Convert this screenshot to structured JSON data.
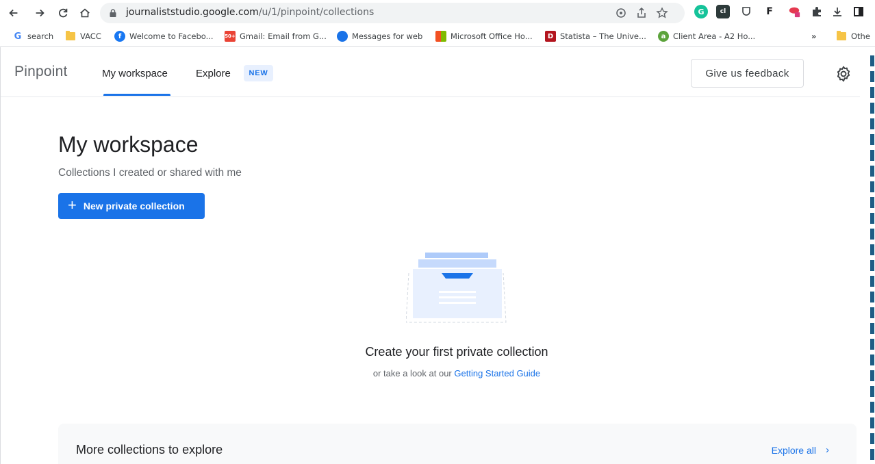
{
  "browser": {
    "url_host": "journaliststudio.google.com",
    "url_path": "/u/1/pinpoint/collections",
    "bookmarks": [
      {
        "label": "search",
        "icon": "google-icon"
      },
      {
        "label": "VACC",
        "icon": "folder-icon"
      },
      {
        "label": "Welcome to Facebo...",
        "icon": "facebook-icon"
      },
      {
        "label": "Gmail: Email from G...",
        "icon": "gmail-icon",
        "badge": "50+"
      },
      {
        "label": "Messages for web",
        "icon": "messages-icon"
      },
      {
        "label": "Microsoft Office Ho...",
        "icon": "microsoft-icon"
      },
      {
        "label": "Statista – The Unive...",
        "icon": "statista-icon"
      },
      {
        "label": "Client Area - A2 Ho...",
        "icon": "a2-icon"
      }
    ],
    "overflow_label": "»",
    "other_bookmarks_label": "Othe"
  },
  "app": {
    "brand": "Pinpoint",
    "tabs": [
      {
        "label": "My workspace",
        "active": true
      },
      {
        "label": "Explore",
        "active": false
      }
    ],
    "new_badge": "NEW",
    "feedback_label": "Give us feedback"
  },
  "main": {
    "title": "My workspace",
    "subtitle": "Collections I created or shared with me",
    "new_button_label": "New private collection",
    "new_button_icon": "+",
    "empty_title": "Create your first private collection",
    "empty_sub_prefix": "or take a look at our",
    "empty_sub_link": "Getting Started Guide"
  },
  "explore_section": {
    "heading": "More collections to explore",
    "explore_all_label": "Explore all",
    "chevron": "›"
  },
  "colors": {
    "accent": "#1a73e8",
    "badge_bg": "#e8f0fe"
  }
}
